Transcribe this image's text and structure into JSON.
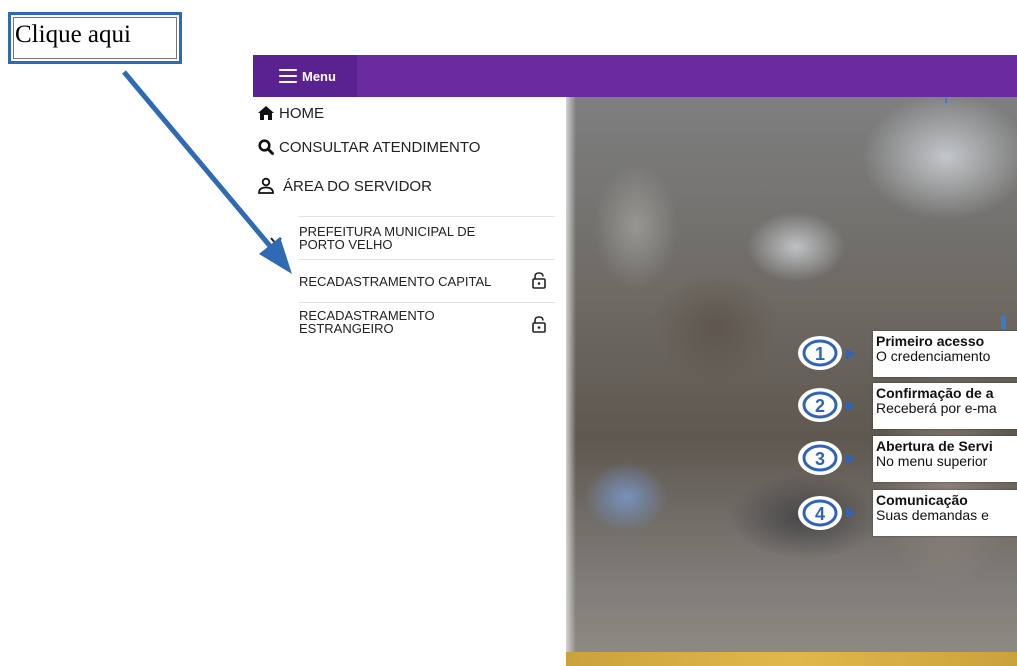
{
  "annotation": {
    "callout_text": "Clique aqui"
  },
  "topbar": {
    "menu_label": "Menu"
  },
  "nav": {
    "home": "HOME",
    "consultar": "CONSULTAR ATENDIMENTO",
    "area_servidor": "ÁREA DO SERVIDOR"
  },
  "submenu": {
    "group_label": "PREFEITURA MUNICIPAL DE PORTO VELHO",
    "items": [
      {
        "label": "RECADASTRAMENTO CAPITAL"
      },
      {
        "label": "RECADASTRAMENTO ESTRANGEIRO"
      }
    ]
  },
  "steps": [
    {
      "number": "1",
      "title": "Primeiro acesso",
      "desc": "O credenciamento"
    },
    {
      "number": "2",
      "title": "Confirmação de a",
      "desc": "Receberá por e-ma"
    },
    {
      "number": "3",
      "title": "Abertura de Servi",
      "desc": "No menu superior"
    },
    {
      "number": "4",
      "title": "Comunicação",
      "desc": "Suas demandas e"
    }
  ],
  "colors": {
    "topbar": "#6a2aa0",
    "accent": "#2f6bb5",
    "step_blue": "#2f64b8"
  }
}
